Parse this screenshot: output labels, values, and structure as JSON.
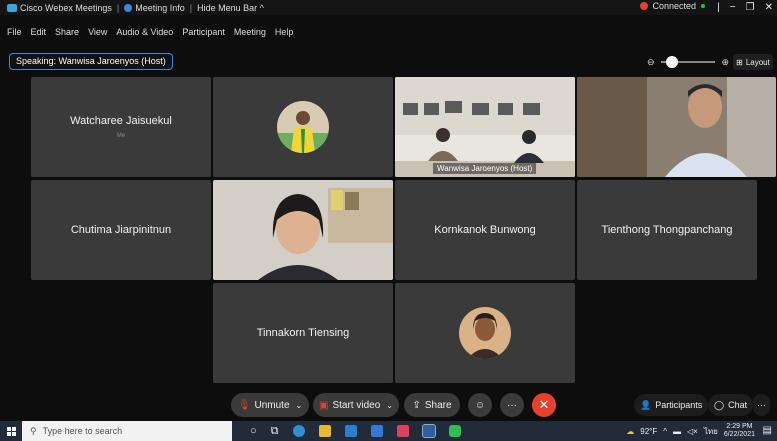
{
  "titlebar": {
    "app_name": "Cisco Webex Meetings",
    "meeting_info": "Meeting Info",
    "hide_menu": "Hide Menu Bar ^",
    "connected": "Connected",
    "win_min": "−",
    "win_max": "❐",
    "win_close": "✕"
  },
  "menu": [
    "File",
    "Edit",
    "Share",
    "View",
    "Audio & Video",
    "Participant",
    "Meeting",
    "Help"
  ],
  "speaking": "Speaking: Wanwisa Jaroenyos (Host)",
  "zoom": {
    "minus": "⊖",
    "plus": "⊕",
    "level": 0.2
  },
  "layout_label": "Layout",
  "participants": {
    "p1": {
      "name": "Watcharee Jaisuekul",
      "me": "Me"
    },
    "p3": {
      "name": "Wanwisa Jaroenyos (Host)"
    },
    "p5": {
      "name": "Chutima Jiarpinitnun"
    },
    "p7": {
      "name": "Kornkanok Bunwong"
    },
    "p8": {
      "name": "Tienthong Thongpanchang"
    },
    "p9": {
      "name": "Tinnakorn Tiensing"
    }
  },
  "controls": {
    "unmute": "Unmute",
    "start_video": "Start video",
    "share": "Share",
    "more": "···",
    "end": "✕",
    "participants": "Participants",
    "chat": "Chat",
    "overflow": "···"
  },
  "taskbar": {
    "search_placeholder": "Type here to search",
    "temp": "92°F",
    "lang": "ไทย",
    "time": "2:29 PM",
    "date": "6/22/2021"
  },
  "colors": {
    "accent": "#39a9e0",
    "end_call": "#e5412f",
    "tile": "#3a3a3a"
  }
}
